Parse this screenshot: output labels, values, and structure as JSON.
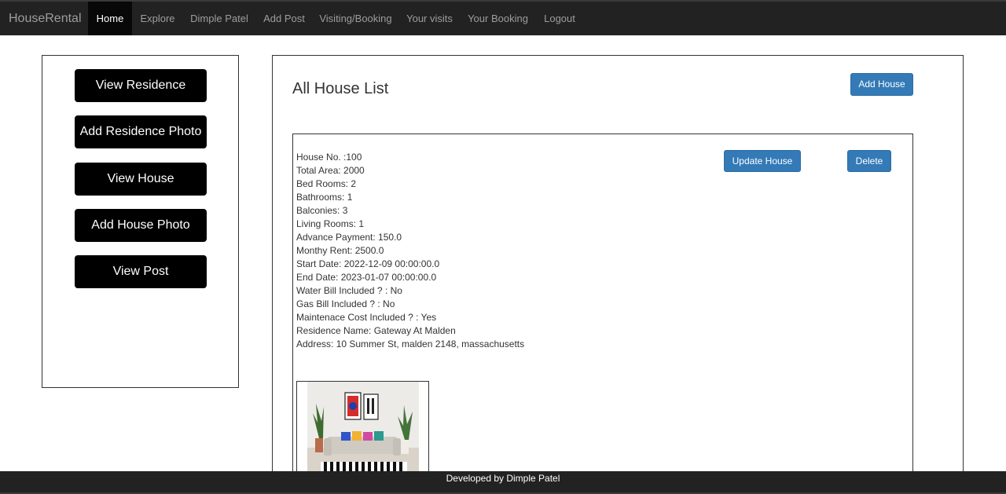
{
  "navbar": {
    "brand": "HouseRental",
    "items": [
      {
        "label": "Home"
      },
      {
        "label": "Explore"
      },
      {
        "label": "Dimple Patel"
      },
      {
        "label": "Add Post"
      },
      {
        "label": "Visiting/Booking"
      },
      {
        "label": "Your visits"
      },
      {
        "label": "Your Booking"
      },
      {
        "label": "Logout"
      }
    ]
  },
  "sidebar": {
    "buttons": [
      {
        "label": "View Residence"
      },
      {
        "label": "Add Residence Photo"
      },
      {
        "label": "View House"
      },
      {
        "label": "Add House Photo"
      },
      {
        "label": "View Post"
      }
    ]
  },
  "main": {
    "title": "All House List",
    "add_house_label": "Add House",
    "house": {
      "update_label": "Update House",
      "delete_label": "Delete",
      "details": [
        "House No. :100",
        "Total Area: 2000",
        "Bed Rooms: 2",
        "Bathrooms: 1",
        "Balconies: 3",
        "Living Rooms: 1",
        "Advance Payment: 150.0",
        "Monthy Rent: 2500.0",
        "Start Date: 2022-12-09 00:00:00.0",
        "End Date: 2023-01-07 00:00:00.0",
        "Water Bill Included ? : No",
        "Gas Bill Included ? : No",
        "Maintenace Cost Included ? : Yes",
        "Residence Name: Gateway At Malden",
        "Address: 10 Summer St, malden 2148, massachusetts"
      ]
    }
  },
  "footer": {
    "text": "Developed by Dimple Patel"
  }
}
